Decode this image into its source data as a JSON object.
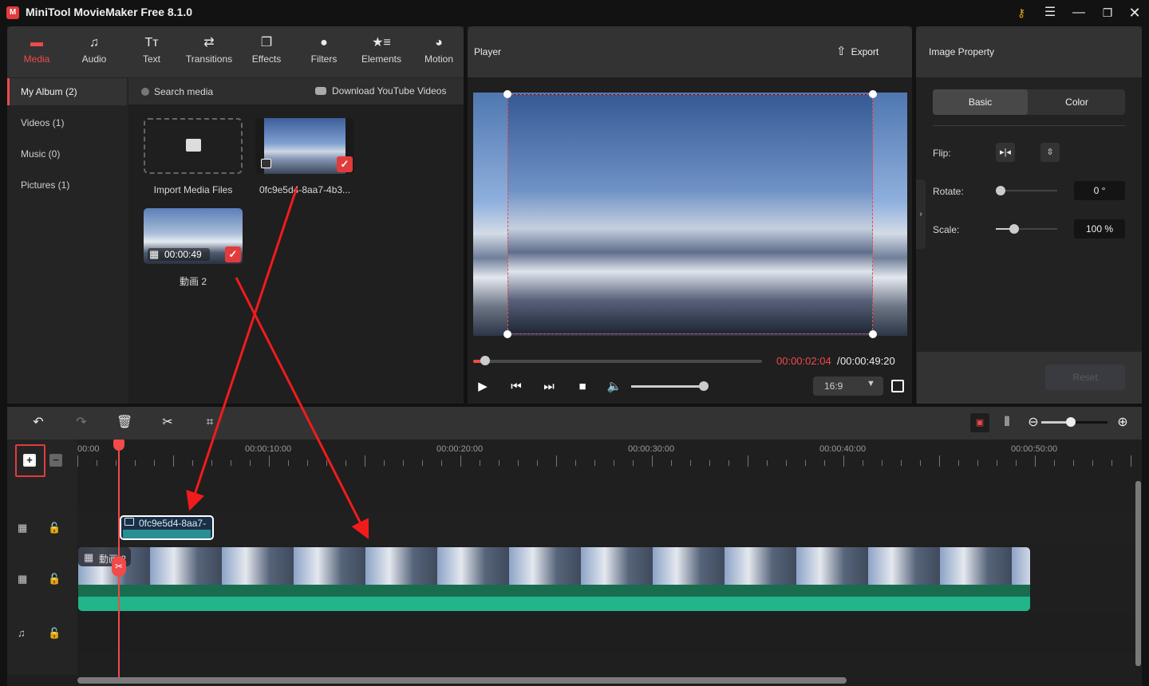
{
  "window": {
    "title": "MiniTool MovieMaker Free 8.1.0",
    "controls": [
      "key-icon",
      "menu-icon",
      "minimize-icon",
      "maximize-icon",
      "close-icon"
    ]
  },
  "toolbar": {
    "tabs": [
      {
        "label": "Media",
        "icon": "folder-icon",
        "active": true
      },
      {
        "label": "Audio",
        "icon": "music-note-icon"
      },
      {
        "label": "Text",
        "icon": "text-icon"
      },
      {
        "label": "Transitions",
        "icon": "transitions-icon"
      },
      {
        "label": "Effects",
        "icon": "effects-icon"
      },
      {
        "label": "Filters",
        "icon": "filters-icon"
      },
      {
        "label": "Elements",
        "icon": "elements-icon"
      },
      {
        "label": "Motion",
        "icon": "motion-icon"
      }
    ]
  },
  "album": {
    "items": [
      {
        "label": "My Album (2)",
        "active": true
      },
      {
        "label": "Videos (1)"
      },
      {
        "label": "Music (0)"
      },
      {
        "label": "Pictures (1)"
      }
    ]
  },
  "media": {
    "search_placeholder": "Search media",
    "download_label": "Download YouTube Videos",
    "import_label": "Import Media Files",
    "items": [
      {
        "name": "0fc9e5d4-8aa7-4b3...",
        "type": "image",
        "selected": true
      },
      {
        "name": "動画 2",
        "type": "video",
        "duration": "00:00:49",
        "selected": true
      }
    ]
  },
  "player": {
    "title": "Player",
    "export_label": "Export",
    "current_time": "00:00:02:04",
    "separator": " / ",
    "total_time": "00:00:49:20",
    "progress_fraction": 0.042,
    "volume_fraction": 1.0,
    "aspect_ratio": "16:9"
  },
  "property": {
    "title": "Image Property",
    "tabs": [
      "Basic",
      "Color"
    ],
    "active_tab": "Basic",
    "flip_label": "Flip:",
    "rotate_label": "Rotate:",
    "rotate_value": "0 °",
    "scale_label": "Scale:",
    "scale_value": "100 %",
    "reset_label": "Reset"
  },
  "timeline": {
    "ruler_labels": [
      "00:00",
      "00:00:10:00",
      "00:00:20:00",
      "00:00:30:00",
      "00:00:40:00",
      "00:00:50:00"
    ],
    "image_clip_label": "0fc9e5d4-8aa7-",
    "video_clip_label": "動画 2",
    "zoom_fraction": 0.45
  },
  "colors": {
    "accent": "#f04a4a",
    "audio_wave": "#22b589",
    "audio_bg": "#196d4f",
    "image_clip": "#2a8f92"
  }
}
